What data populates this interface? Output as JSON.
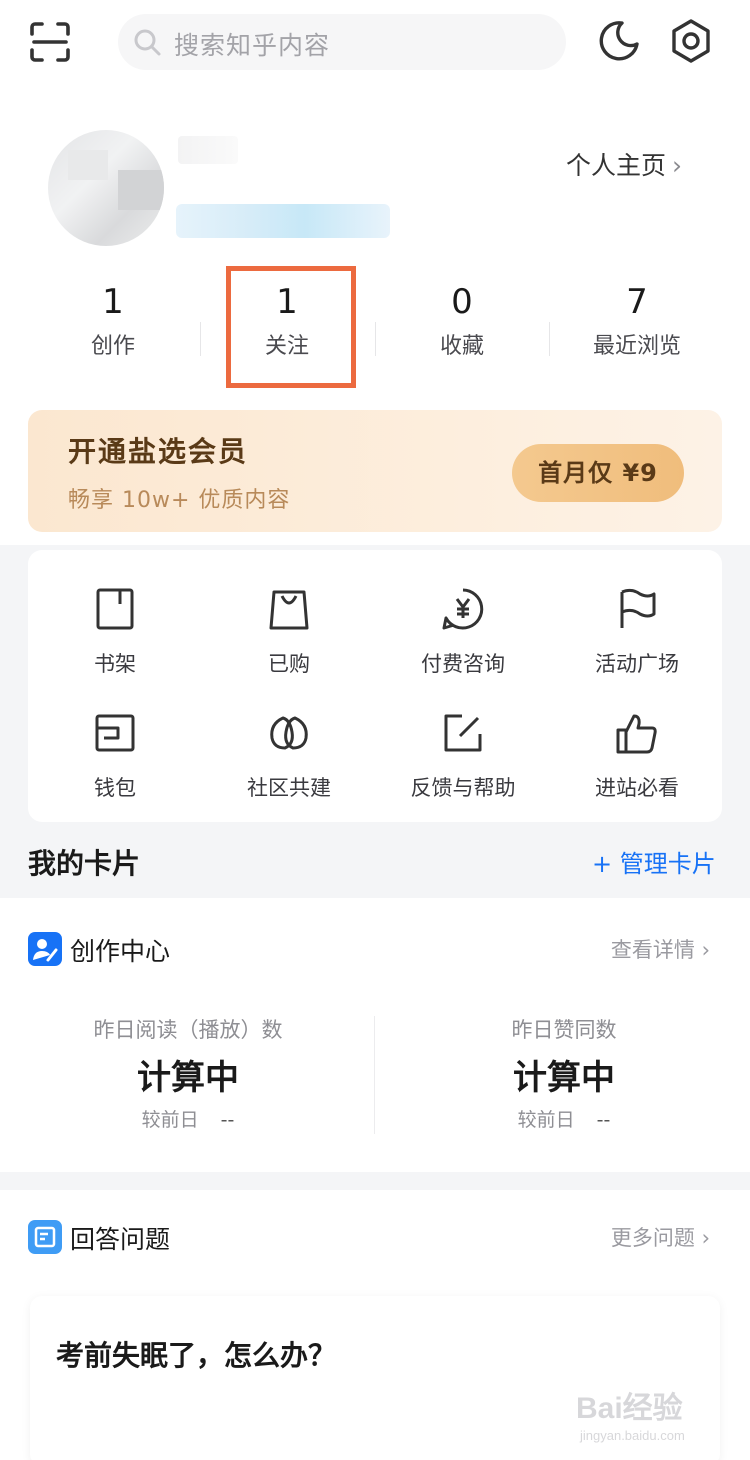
{
  "search": {
    "placeholder": "搜索知乎内容"
  },
  "profile": {
    "link_label": "个人主页",
    "chevron": "›"
  },
  "stats": [
    {
      "value": "1",
      "label": "创作"
    },
    {
      "value": "1",
      "label": "关注"
    },
    {
      "value": "0",
      "label": "收藏"
    },
    {
      "value": "7",
      "label": "最近浏览"
    }
  ],
  "vip": {
    "title": "开通盐选会员",
    "subtitle": "畅享 10w+ 优质内容",
    "button": "首月仅 ¥9"
  },
  "grid": [
    {
      "label": "书架",
      "icon": "bookshelf-icon"
    },
    {
      "label": "已购",
      "icon": "shopping-bag-icon"
    },
    {
      "label": "付费咨询",
      "icon": "paid-consult-icon"
    },
    {
      "label": "活动广场",
      "icon": "flag-icon"
    },
    {
      "label": "钱包",
      "icon": "wallet-icon"
    },
    {
      "label": "社区共建",
      "icon": "community-icon"
    },
    {
      "label": "反馈与帮助",
      "icon": "feedback-icon"
    },
    {
      "label": "进站必看",
      "icon": "thumbs-up-icon"
    }
  ],
  "cards": {
    "title": "我的卡片",
    "manage": "+ 管理卡片"
  },
  "creation": {
    "title": "创作中心",
    "more": "查看详情 ›",
    "metrics": [
      {
        "label": "昨日阅读（播放）数",
        "value": "计算中",
        "compare_label": "较前日",
        "compare_value": "--"
      },
      {
        "label": "昨日赞同数",
        "value": "计算中",
        "compare_label": "较前日",
        "compare_value": "--"
      }
    ]
  },
  "answer": {
    "title": "回答问题",
    "more": "更多问题 ›",
    "question": "考前失眠了，怎么办？"
  },
  "watermark": {
    "text": "Bai经验",
    "sub": "jingyan.baidu.com"
  },
  "colors": {
    "accent": "#1772f6",
    "highlight": "#ec6a3f",
    "vip_text": "#5a3a17"
  }
}
